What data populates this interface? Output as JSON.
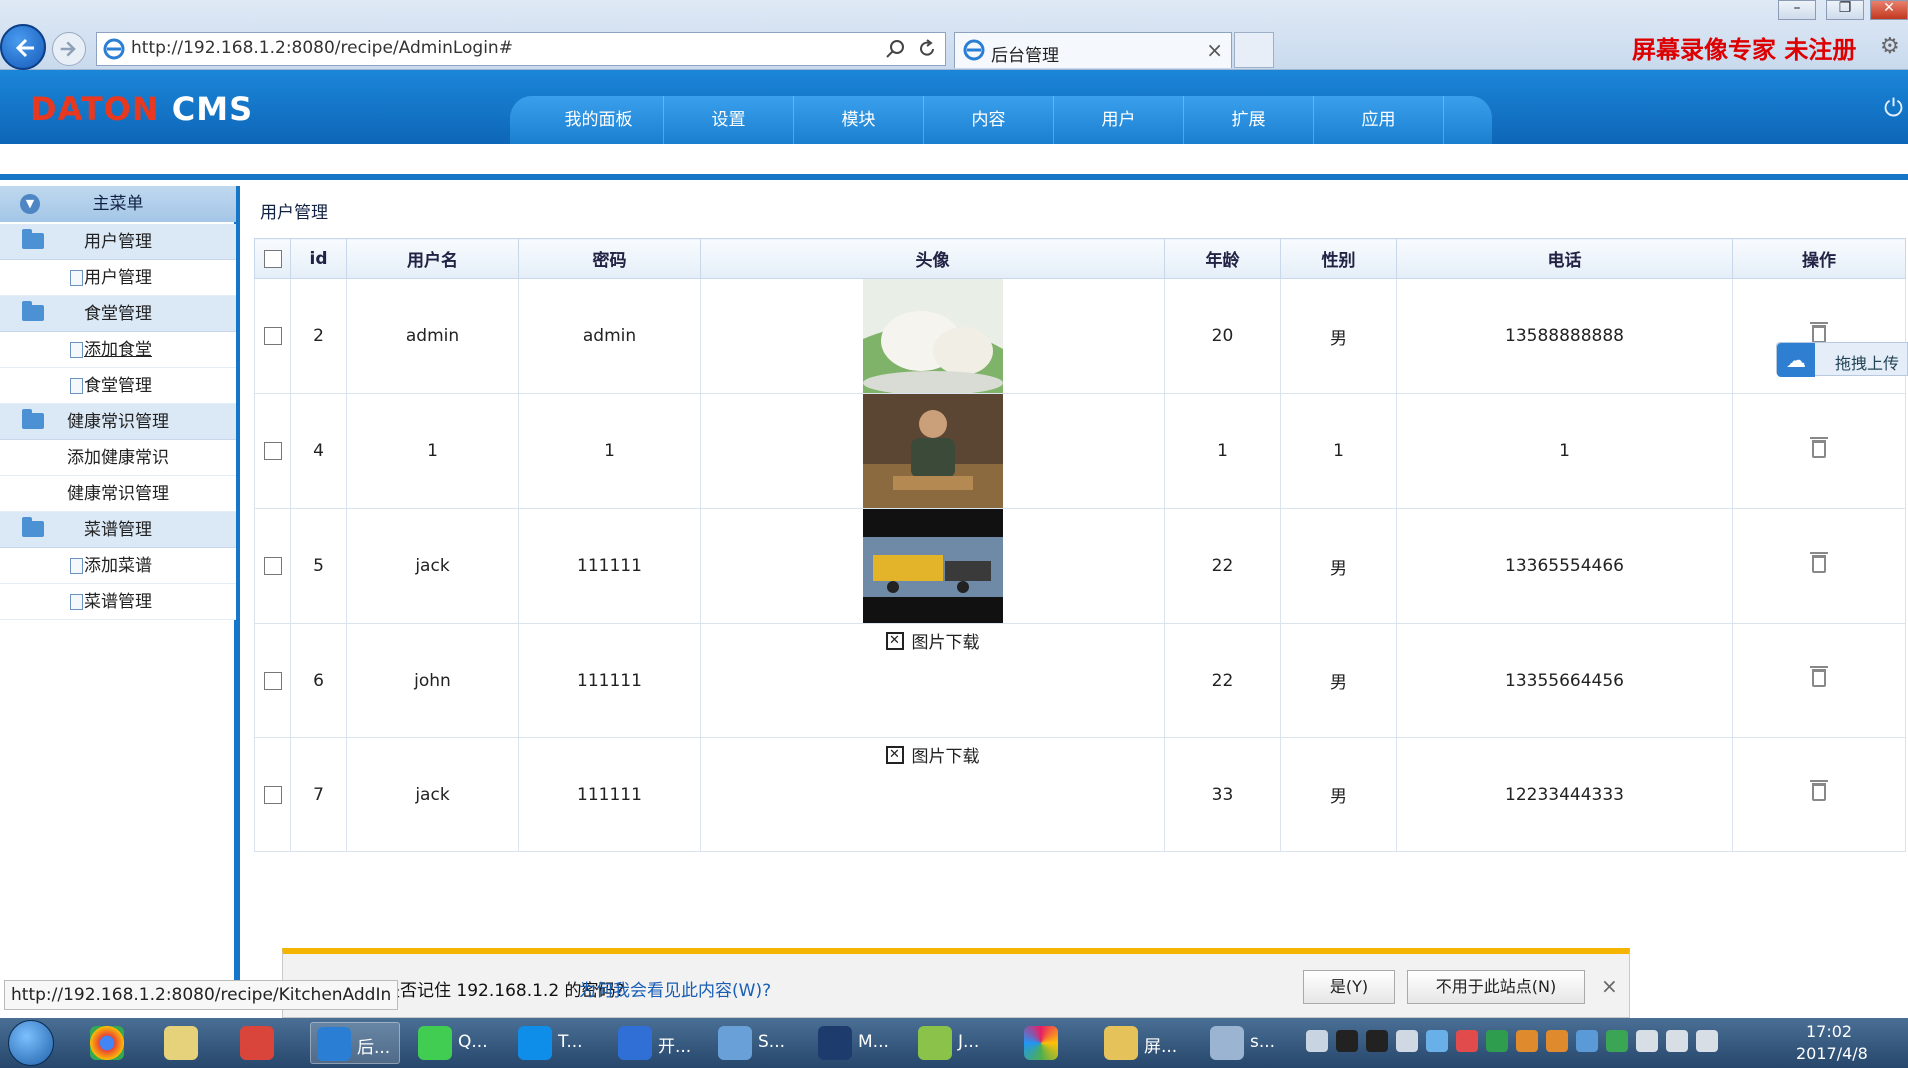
{
  "browser": {
    "url": "http://192.168.1.2:8080/recipe/AdminLogin#",
    "tab_title": "后台管理",
    "tab_close": "×",
    "recorder": "屏幕录像专家  未注册",
    "status_url": "http://192.168.1.2:8080/recipe/KitchenAddIn"
  },
  "logo": {
    "part1": "DATON",
    "part2": "CMS"
  },
  "topnav": [
    "我的面板",
    "设置",
    "模块",
    "内容",
    "用户",
    "扩展",
    "应用"
  ],
  "sidebar": {
    "main": "主菜单",
    "groups": [
      {
        "label": "用户管理",
        "items": [
          "用户管理"
        ]
      },
      {
        "label": "食堂管理",
        "items": [
          "添加食堂",
          "食堂管理"
        ]
      },
      {
        "label": "健康常识管理",
        "items": [
          "添加健康常识",
          "健康常识管理"
        ]
      },
      {
        "label": "菜谱管理",
        "items": [
          "添加菜谱",
          "菜谱管理"
        ]
      }
    ]
  },
  "breadcrumb": "用户管理",
  "table": {
    "headers": [
      "id",
      "用户名",
      "密码",
      "头像",
      "年龄",
      "性别",
      "电话",
      "操作"
    ],
    "rows": [
      {
        "id": "2",
        "username": "admin",
        "password": "admin",
        "avatar": "photo-dumplings",
        "age": "20",
        "gender": "男",
        "phone": "13588888888"
      },
      {
        "id": "4",
        "username": "1",
        "password": "1",
        "avatar": "photo-person",
        "age": "1",
        "gender": "1",
        "phone": "1"
      },
      {
        "id": "5",
        "username": "jack",
        "password": "111111",
        "avatar": "photo-truck",
        "age": "22",
        "gender": "男",
        "phone": "13365554466"
      },
      {
        "id": "6",
        "username": "john",
        "password": "111111",
        "avatar": "broken",
        "age": "22",
        "gender": "男",
        "phone": "13355664456"
      },
      {
        "id": "7",
        "username": "jack",
        "password": "111111",
        "avatar": "broken",
        "age": "33",
        "gender": "男",
        "phone": "12233444333"
      }
    ],
    "broken_image_label": "图片下载"
  },
  "upload_float": "拖拽上传",
  "password_prompt": {
    "text": "是否记住 192.168.1.2 的密码?",
    "why": "为何我会看见此内容(W)?",
    "yes": "是(Y)",
    "never": "不用于此站点(N)",
    "close": "×"
  },
  "taskbar": {
    "apps": [
      {
        "label": "后...",
        "icon": "ie-icon"
      },
      {
        "label": "Q...",
        "icon": "qt-icon"
      },
      {
        "label": "T...",
        "icon": "teamviewer-icon"
      },
      {
        "label": "开...",
        "icon": "wps-icon"
      },
      {
        "label": "S...",
        "icon": "sqlyog-icon"
      },
      {
        "label": "M...",
        "icon": "myeclipse-icon"
      },
      {
        "label": "J...",
        "icon": "json-icon"
      },
      {
        "label": "屏...",
        "icon": "folder-icon"
      },
      {
        "label": "s...",
        "icon": "search-icon"
      }
    ],
    "time": "17:02",
    "date": "2017/4/8"
  },
  "colors": {
    "brand_blue": "#1677c8",
    "logo_red": "#e8381f",
    "prompt_yellow": "#f4b400"
  }
}
